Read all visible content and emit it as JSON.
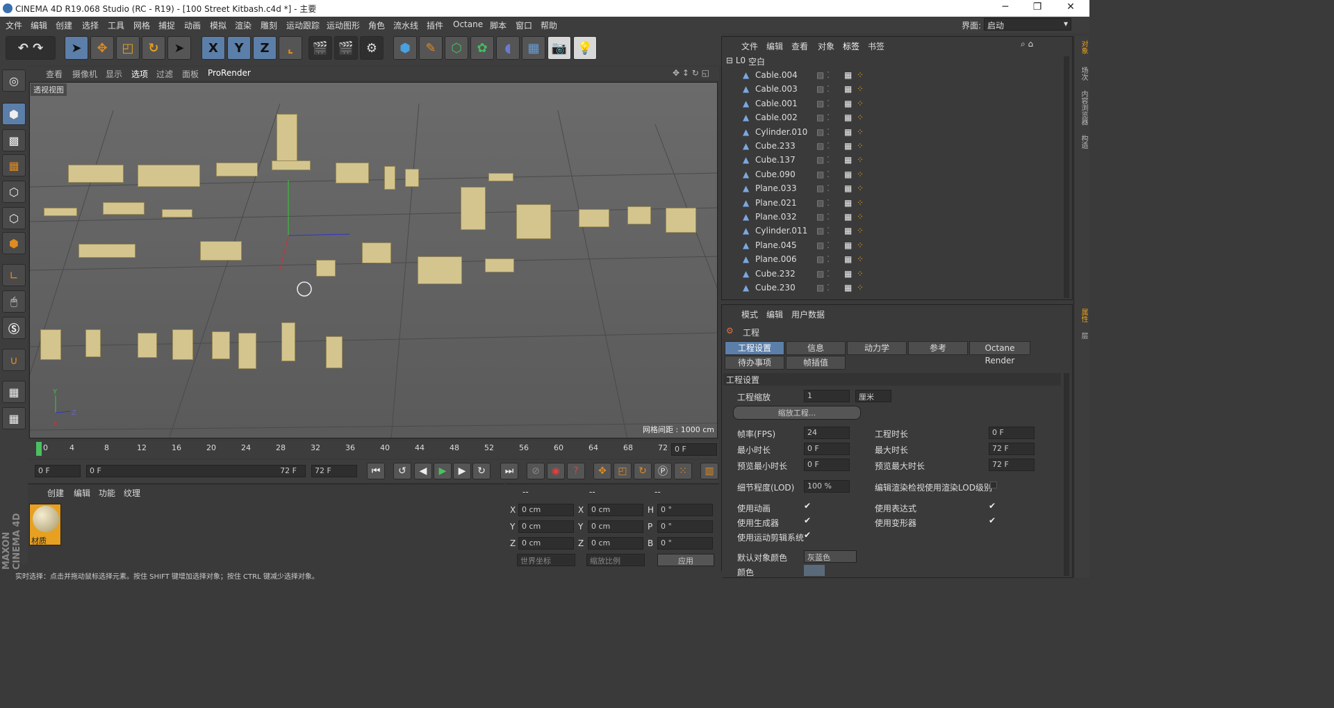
{
  "window": {
    "title": "CINEMA 4D R19.068 Studio (RC - R19) - [100 Street Kitbash.c4d *] - 主要"
  },
  "menu": [
    "文件",
    "编辑",
    "创建",
    "选择",
    "工具",
    "网格",
    "捕捉",
    "动画",
    "模拟",
    "渲染",
    "雕刻",
    "运动跟踪",
    "运动图形",
    "角色",
    "流水线",
    "插件",
    "Octane",
    "脚本",
    "窗口",
    "帮助"
  ],
  "layout": {
    "label": "界面:",
    "value": "启动"
  },
  "viewport": {
    "menu": [
      "查看",
      "摄像机",
      "显示",
      "选项",
      "过滤",
      "面板",
      "ProRender"
    ],
    "name": "透视视图",
    "grid_label": "网格间距 : 1000 cm"
  },
  "timeline": {
    "ticks": [
      "0",
      "4",
      "8",
      "12",
      "16",
      "20",
      "24",
      "28",
      "32",
      "36",
      "40",
      "44",
      "48",
      "52",
      "56",
      "60",
      "64",
      "68",
      "72"
    ],
    "current": "0 F",
    "start": "0 F",
    "range_start": "0 F",
    "range_end": "72 F",
    "end": "72 F"
  },
  "materials": {
    "menu": [
      "创建",
      "编辑",
      "功能",
      "纹理"
    ],
    "items": [
      {
        "name": "材质"
      }
    ]
  },
  "coords": {
    "header": [
      "--",
      "--",
      "--"
    ],
    "rows": [
      {
        "a": "X",
        "av": "0 cm",
        "b": "X",
        "bv": "0 cm",
        "c": "H",
        "cv": "0 °"
      },
      {
        "a": "Y",
        "av": "0 cm",
        "b": "Y",
        "bv": "0 cm",
        "c": "P",
        "cv": "0 °"
      },
      {
        "a": "Z",
        "av": "0 cm",
        "b": "Z",
        "bv": "0 cm",
        "c": "B",
        "cv": "0 °"
      }
    ],
    "world": "世界坐标",
    "scale": "缩放比例",
    "apply": "应用"
  },
  "objects": {
    "menu": [
      "文件",
      "编辑",
      "查看",
      "对象",
      "标签",
      "书签"
    ],
    "root": "空白",
    "items": [
      "Cable.004",
      "Cable.003",
      "Cable.001",
      "Cable.002",
      "Cylinder.010",
      "Cube.233",
      "Cube.137",
      "Cube.090",
      "Plane.033",
      "Plane.021",
      "Plane.032",
      "Cylinder.011",
      "Plane.045",
      "Plane.006",
      "Cube.232",
      "Cube.230"
    ]
  },
  "attributes": {
    "menu": [
      "模式",
      "编辑",
      "用户数据"
    ],
    "title": "工程",
    "tabs": [
      "工程设置",
      "信息",
      "动力学",
      "参考",
      "Octane Render"
    ],
    "tabs2": [
      "待办事项",
      "帧插值"
    ],
    "section": "工程设置",
    "scale_label": "工程缩放",
    "scale_value": "1",
    "scale_unit": "厘米",
    "scale_btn": "缩放工程...",
    "fps_label": "帧率(FPS)",
    "fps": "24",
    "len_label": "工程时长",
    "len": "0 F",
    "min_label": "最小时长",
    "min": "0 F",
    "max_label": "最大时长",
    "max": "72 F",
    "pmin_label": "预览最小时长",
    "pmin": "0 F",
    "pmax_label": "预览最大时长",
    "pmax": "72 F",
    "lod_label": "细节程度(LOD)",
    "lod": "100 %",
    "lod2_label": "编辑渲染检视使用渲染LOD级别",
    "anim_label": "使用动画",
    "expr_label": "使用表达式",
    "gen_label": "使用生成器",
    "deform_label": "使用变形器",
    "motion_label": "使用运动剪辑系统",
    "defcolor_label": "默认对象颜色",
    "defcolor": "灰蓝色",
    "color_label": "颜色"
  },
  "rightstrip": [
    "对象",
    "场次",
    "内容浏览器",
    "构造",
    "属性",
    "层"
  ],
  "status": "实时选择：点击并拖动鼠标选择元素。按住 SHIFT 键增加选择对象；按住 CTRL 键减少选择对象。",
  "brand": "MAXON CINEMA 4D"
}
